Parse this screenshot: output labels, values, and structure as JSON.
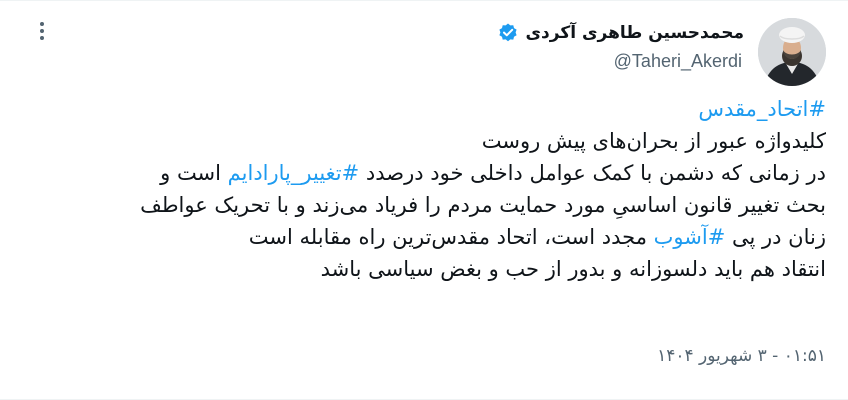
{
  "author": {
    "display_name": "محمدحسین طاهری آکردی",
    "handle": "@Taheri_Akerdi",
    "verified_color": "#1d9bf0"
  },
  "icons": {
    "verified": "verified-badge-icon",
    "more": "more-vertical-icon"
  },
  "tweet": {
    "line1": {
      "hashtag": "#اتحاد_مقدس"
    },
    "line2": {
      "text": "کلیدواژه عبور از بحران‌های پیش روست"
    },
    "line3": {
      "before": "در زمانی که دشمن با کمک عوامل داخلی خود درصدد ",
      "hashtag": "#تغییر_پارادایم",
      "after": " است و"
    },
    "line4": {
      "text": "بحث تغییر قانون اساسیِ مورد حمایت مردم را فریاد می‌زند و با تحریک عواطف"
    },
    "line5": {
      "before": "زنان در پی ",
      "hashtag": "#آشوب",
      "after": " مجدد است، اتحاد مقدس‌ترین راه مقابله است"
    },
    "line6": {
      "text": "انتقاد هم باید دلسوزانه و بدور از حب و بغض سیاسی باشد"
    }
  },
  "timestamp": "۰۱:۵۱ - ۳ شهریور ۱۴۰۴",
  "colors": {
    "text": "#0f1419",
    "secondary": "#536471",
    "link": "#1d9bf0"
  }
}
